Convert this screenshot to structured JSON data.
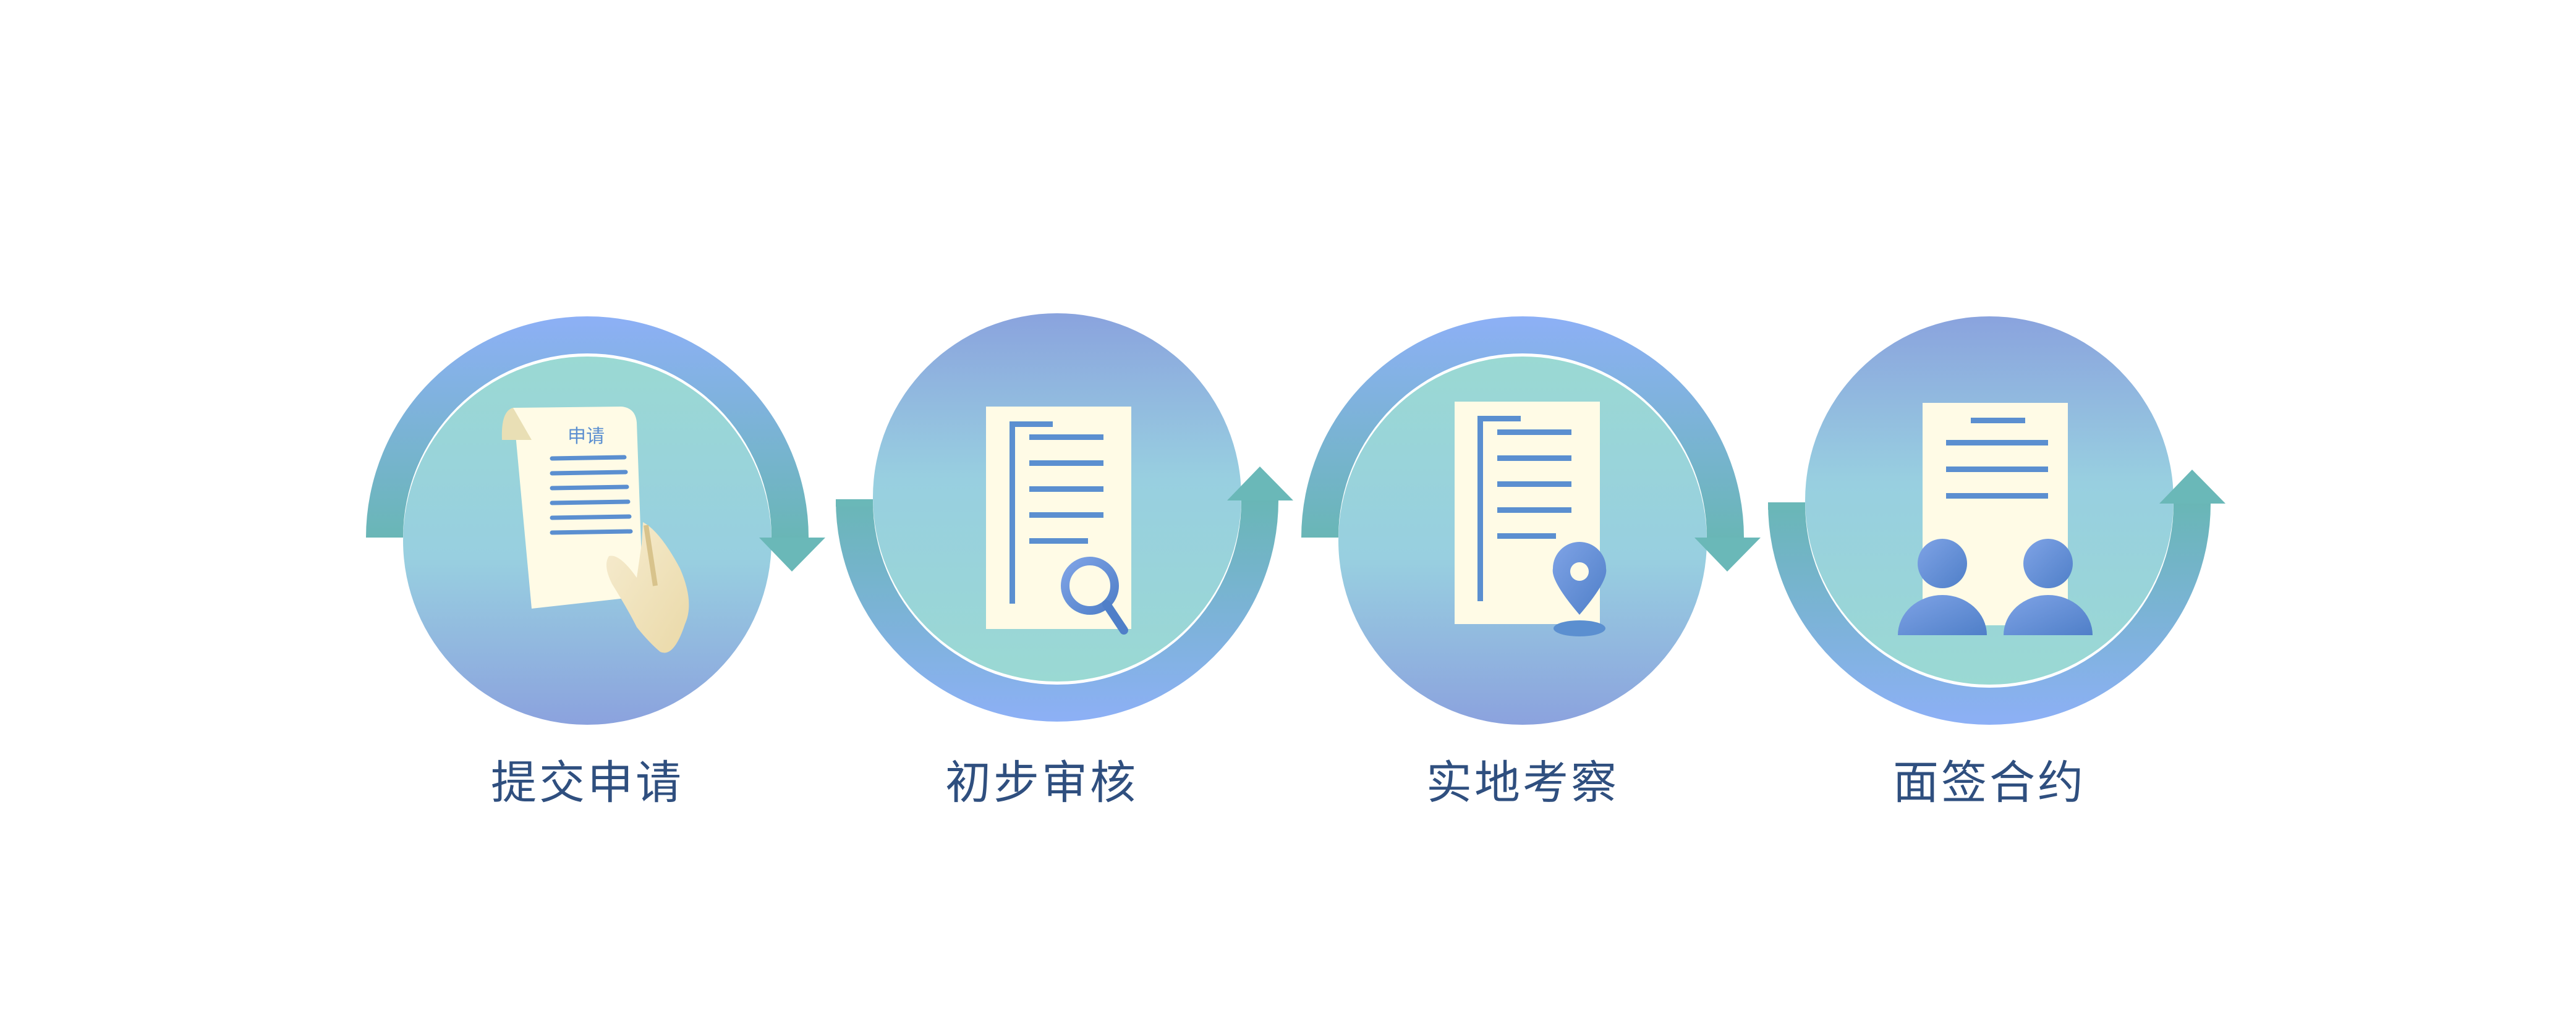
{
  "steps": [
    {
      "label": "提交申请",
      "document_title": "申请",
      "icon": "hand-holding-document-icon"
    },
    {
      "label": "初步审核",
      "icon": "document-magnifier-icon"
    },
    {
      "label": "实地考察",
      "icon": "document-location-pin-icon"
    },
    {
      "label": "面签合约",
      "icon": "document-two-people-icon"
    }
  ],
  "colors": {
    "label_text": "#2f4f7f",
    "ring_blue": "#8aaef5",
    "ring_teal": "#6ab8b8",
    "inner_teal": "#9bd8d4",
    "inner_blue": "#8aa5de",
    "paper": "#fffbe6",
    "line_blue": "#5b8fd0",
    "arrow_teal": "#6ab8b8"
  }
}
